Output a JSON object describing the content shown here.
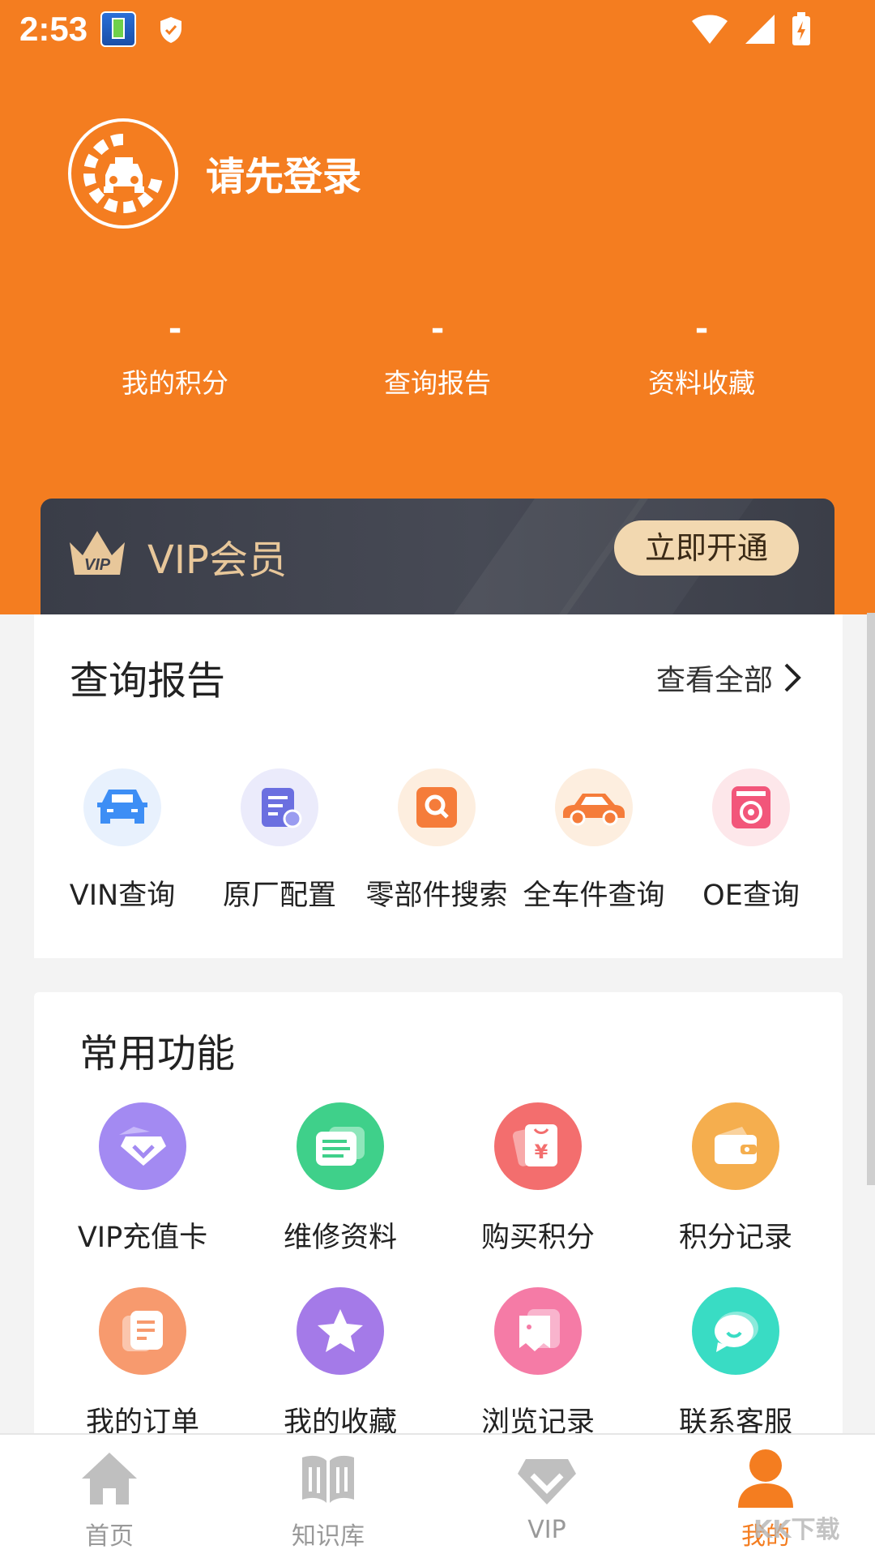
{
  "status_bar": {
    "time": "2:53"
  },
  "header": {
    "login_prompt": "请先登录",
    "stats": [
      {
        "value": "-",
        "label": "我的积分"
      },
      {
        "value": "-",
        "label": "查询报告"
      },
      {
        "value": "-",
        "label": "资料收藏"
      }
    ],
    "vip": {
      "label": "VIP会员",
      "crown_text": "VIP",
      "button": "立即开通"
    }
  },
  "reports": {
    "title": "查询报告",
    "view_all": "查看全部",
    "items": [
      {
        "label": "VIN查询",
        "icon": "car-front-icon",
        "bg": "#e8f1fd",
        "color": "#3d8ef5"
      },
      {
        "label": "原厂配置",
        "icon": "config-doc-icon",
        "bg": "#ebebfb",
        "color": "#6b6fe0"
      },
      {
        "label": "零部件搜索",
        "icon": "search-box-icon",
        "bg": "#fdeedf",
        "color": "#f57c3a"
      },
      {
        "label": "全车件查询",
        "icon": "car-side-icon",
        "bg": "#fdeedf",
        "color": "#f57c3a"
      },
      {
        "label": "OE查询",
        "icon": "washer-icon",
        "bg": "#fde7ea",
        "color": "#f2567a"
      }
    ]
  },
  "functions": {
    "title": "常用功能",
    "items": [
      {
        "label": "VIP充值卡",
        "icon": "vip-card-icon",
        "color": "#a38af2"
      },
      {
        "label": "维修资料",
        "icon": "repair-doc-icon",
        "color": "#3fd08a"
      },
      {
        "label": "购买积分",
        "icon": "yen-icon",
        "color": "#f36e6e"
      },
      {
        "label": "积分记录",
        "icon": "wallet-icon",
        "color": "#f5ae4e"
      },
      {
        "label": "我的订单",
        "icon": "order-icon",
        "color": "#f79a6e"
      },
      {
        "label": "我的收藏",
        "icon": "star-icon",
        "color": "#a47ae8"
      },
      {
        "label": "浏览记录",
        "icon": "history-icon",
        "color": "#f57ba6"
      },
      {
        "label": "联系客服",
        "icon": "chat-icon",
        "color": "#39dcc4"
      }
    ]
  },
  "bottom_nav": {
    "items": [
      {
        "label": "首页",
        "icon": "home-icon"
      },
      {
        "label": "知识库",
        "icon": "book-icon"
      },
      {
        "label": "VIP",
        "icon": "vip-diamond-icon"
      },
      {
        "label": "我的",
        "icon": "person-icon"
      }
    ]
  },
  "watermark": "KK下载",
  "colors": {
    "brand": "#f47d20",
    "vip_gold": "#e8c79a",
    "vip_dark": "#3f424d"
  }
}
